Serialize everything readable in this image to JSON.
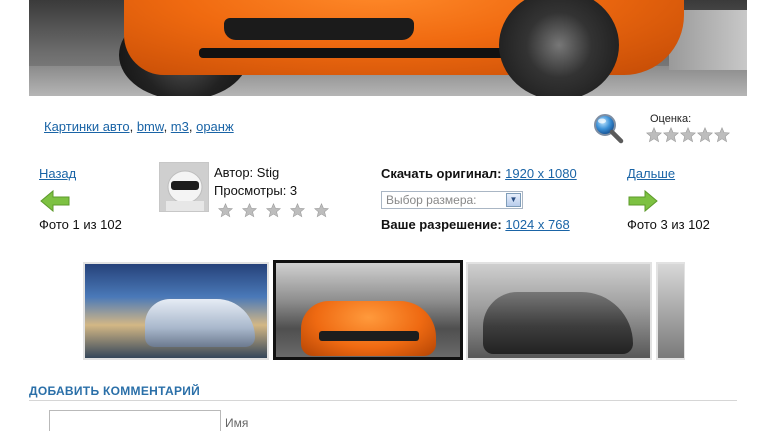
{
  "main_photo": {
    "alt": ""
  },
  "tags": {
    "items": [
      {
        "label": "Картинки авто"
      },
      {
        "label": "bmw"
      },
      {
        "label": "m3"
      },
      {
        "label": "оранж"
      }
    ],
    "separator": ", "
  },
  "rating": {
    "label": "Оценка:",
    "stars": 5,
    "value": 0
  },
  "nav": {
    "prev_label": "Назад",
    "next_label": "Дальше",
    "prev_count": "Фото 1 из 102",
    "next_count": "Фото 3 из 102"
  },
  "author": {
    "author_line": "Автор: Stig",
    "views_line": "Просмотры: 3",
    "stars": 5,
    "value": 0
  },
  "download": {
    "label": "Скачать оригинал:",
    "original_size": "1920 x 1080",
    "select_placeholder": "Выбор размера:",
    "resolution_label": "Ваше разрешение:",
    "resolution_value": "1024 x 768"
  },
  "thumbnails": [
    {
      "name": "thumb-1",
      "active": false
    },
    {
      "name": "thumb-2",
      "active": true
    },
    {
      "name": "thumb-3",
      "active": false
    },
    {
      "name": "thumb-4",
      "active": false
    }
  ],
  "comment": {
    "title": "ДОБАВИТЬ КОММЕНТАРИЙ",
    "name_label": "Имя",
    "name_value": ""
  },
  "colors": {
    "link": "#1a64a6",
    "section_title": "#2a6fa8",
    "arrow": "#7dc142",
    "star": "#bdbdbd"
  },
  "icons": [
    "magnifier-icon",
    "star-icon",
    "arrow-left-icon",
    "arrow-right-icon",
    "dropdown-arrow-icon"
  ]
}
